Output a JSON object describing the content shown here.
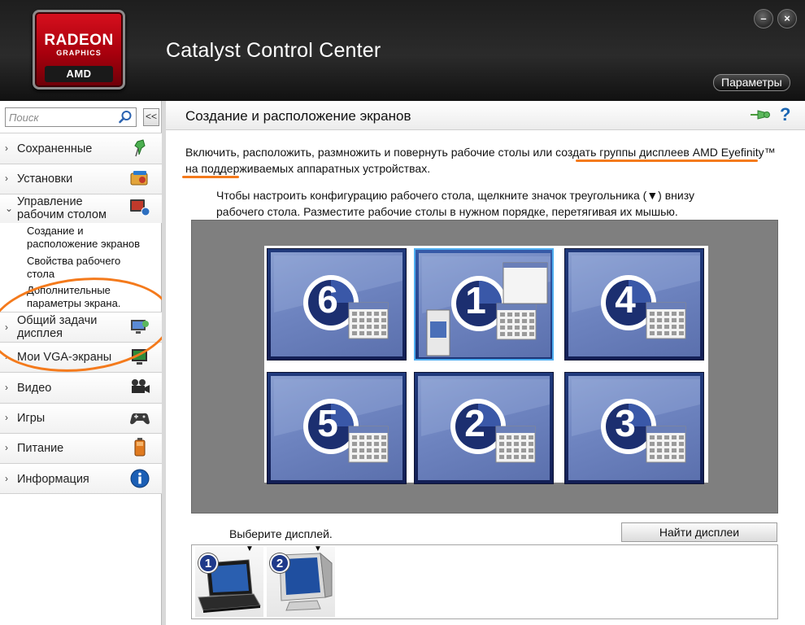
{
  "app": {
    "title": "Catalyst Control Center",
    "logo": {
      "brand": "RADEON",
      "subtitle": "GRAPHICS",
      "maker": "AMD"
    },
    "params_label": "Параметры",
    "minimize_glyph": "–",
    "close_glyph": "×",
    "accent_color": "#f47a1c"
  },
  "sidebar": {
    "search_placeholder": "Поиск",
    "collapse_glyph": "<<",
    "items": [
      {
        "label": "Сохраненные",
        "chevron": "›",
        "icon": "pin-icon"
      },
      {
        "label": "Установки",
        "chevron": "›",
        "icon": "presets-icon"
      },
      {
        "label_line1": "Управление",
        "label_line2": "рабочим столом",
        "chevron": "⌄",
        "icon": "desktop-management-icon",
        "expanded": true
      },
      {
        "label_line1": "Общий задачи",
        "label_line2": "дисплея",
        "chevron": "›",
        "icon": "display-tasks-icon"
      },
      {
        "label": "Мои VGA-экраны",
        "chevron": "›",
        "icon": "vga-monitor-icon"
      },
      {
        "label": "Видео",
        "chevron": "›",
        "icon": "video-camera-icon"
      },
      {
        "label": "Игры",
        "chevron": "›",
        "icon": "gamepad-icon"
      },
      {
        "label": "Питание",
        "chevron": "›",
        "icon": "battery-icon"
      },
      {
        "label": "Информация",
        "chevron": "›",
        "icon": "info-icon"
      }
    ],
    "subitems": [
      {
        "line1": "Создание и",
        "line2": "расположение экранов"
      },
      {
        "line1": "Свойства рабочего",
        "line2": "стола"
      },
      {
        "line1": "Дополнительные",
        "line2": "параметры экрана."
      }
    ]
  },
  "main": {
    "title": "Создание и расположение экранов",
    "help_glyph": "?",
    "intro_prefix": "Включить, расположить, размножить и повернуть рабочие столы или ",
    "intro_link": "создать группы дисплеев AMD Eyefinity™",
    "intro_suffix": " на поддерживаемых аппаратных устройствах.",
    "instructions_line1": "Чтобы настроить конфигурацию рабочего стола, щелкните значок треугольника (▼) внизу",
    "instructions_line2": "рабочего стола.  Разместите рабочие столы в нужном порядке, перетягивая их мышью.",
    "desktops": [
      {
        "number": "6",
        "selected": false
      },
      {
        "number": "1",
        "selected": true
      },
      {
        "number": "4",
        "selected": false
      },
      {
        "number": "5",
        "selected": false
      },
      {
        "number": "2",
        "selected": false
      },
      {
        "number": "3",
        "selected": false
      }
    ],
    "select_label": "Выберите дисплей.",
    "find_button": "Найти дисплеи",
    "displays": [
      {
        "number": "1",
        "type": "laptop-icon",
        "arrow": "▼"
      },
      {
        "number": "2",
        "type": "crt-monitor-icon",
        "arrow": "▼"
      }
    ]
  }
}
